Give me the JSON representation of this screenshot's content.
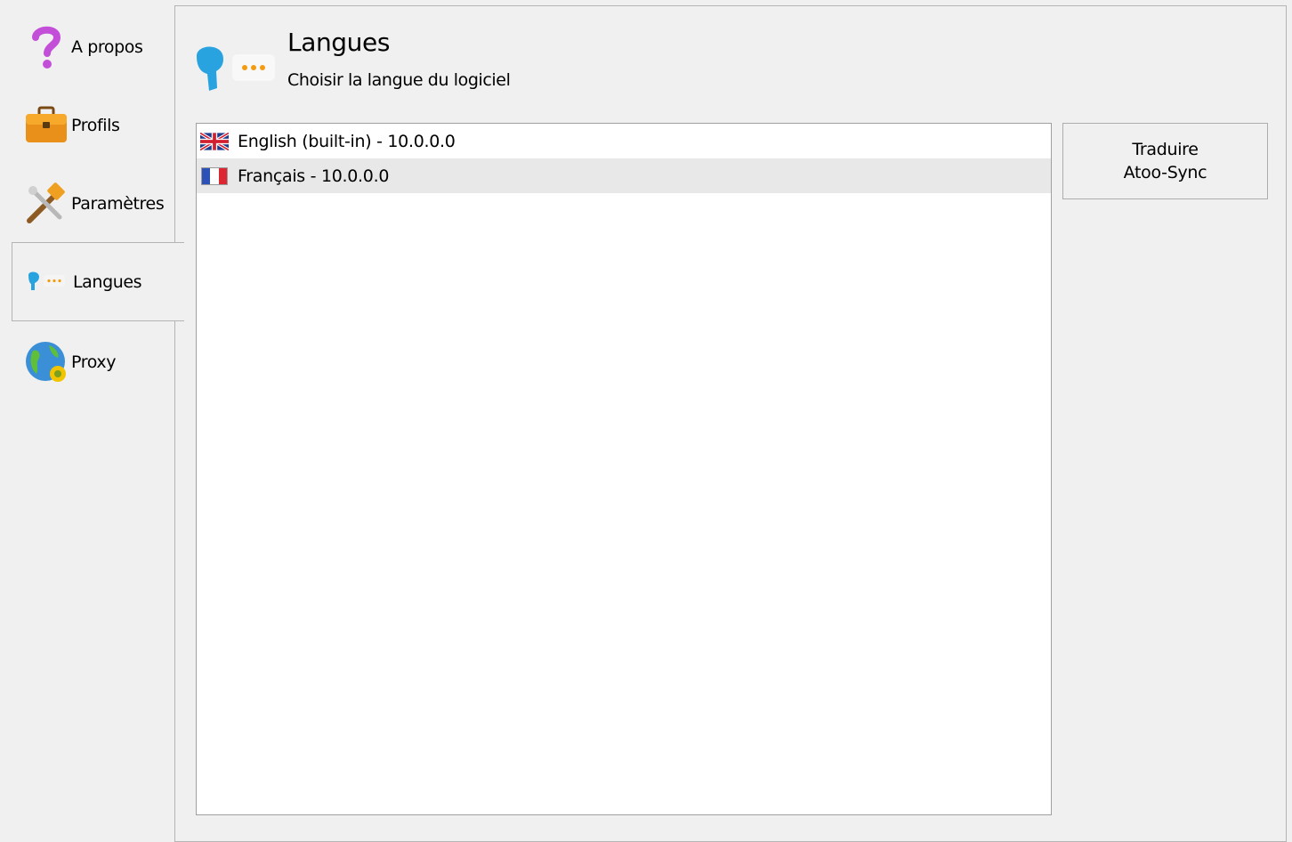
{
  "sidebar": {
    "items": [
      {
        "label": "A propos",
        "icon": "question-icon"
      },
      {
        "label": "Profils",
        "icon": "briefcase-icon"
      },
      {
        "label": "Paramètres",
        "icon": "tools-icon"
      },
      {
        "label": "Langues",
        "icon": "speech-icon",
        "active": true
      },
      {
        "label": "Proxy",
        "icon": "globe-gear-icon"
      }
    ]
  },
  "header": {
    "title": "Langues",
    "subtitle": "Choisir la langue du logiciel",
    "icon": "speech-icon"
  },
  "languages": {
    "items": [
      {
        "label": "English (built-in) - 10.0.0.0",
        "flag": "uk-flag-icon",
        "selected": false
      },
      {
        "label": "Français - 10.0.0.0",
        "flag": "france-flag-icon",
        "selected": true
      }
    ]
  },
  "actions": {
    "translate_line1": "Traduire",
    "translate_line2": "Atoo-Sync"
  },
  "colors": {
    "accent_blue": "#29a3e0",
    "accent_orange": "#f39c12",
    "question_purple": "#c34fd9",
    "selection": "#e8e8e8"
  }
}
